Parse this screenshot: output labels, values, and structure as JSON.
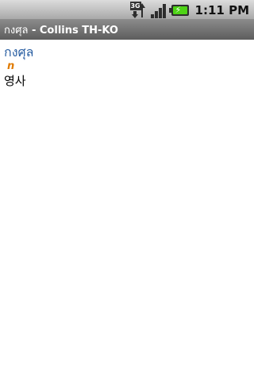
{
  "status_bar": {
    "network_label": "3G",
    "time": "1:11 PM",
    "icons": [
      "3g-data-icon",
      "signal-strength-icon",
      "battery-charging-icon"
    ]
  },
  "title_bar": {
    "word": "กงศุล",
    "separator": " - ",
    "dictionary": "Collins TH-KO"
  },
  "entry": {
    "headword": "กงศุล",
    "part_of_speech": "n",
    "translation": "영사"
  },
  "colors": {
    "headword": "#2a5fa2",
    "part_of_speech": "#e07b00",
    "title_bar": "#6f6f6f"
  }
}
